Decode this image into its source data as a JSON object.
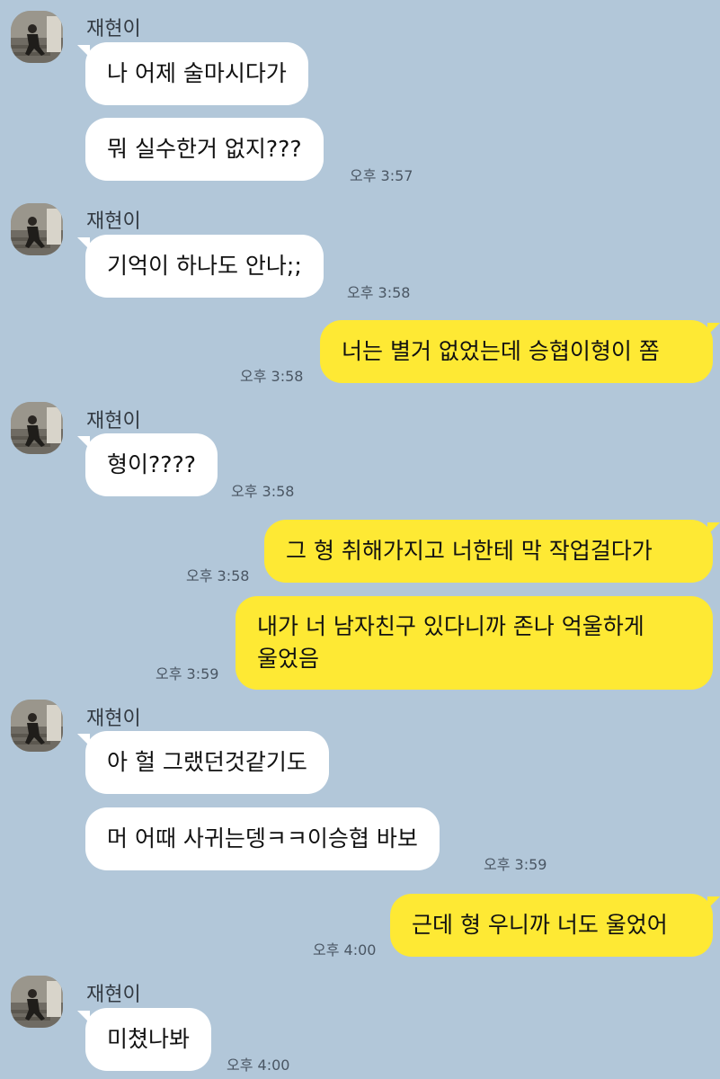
{
  "chat": {
    "partner_name": "재현이",
    "colors": {
      "background": "#b2c7d9",
      "my_bubble": "#fee934",
      "their_bubble": "#ffffff"
    },
    "messages": [
      {
        "from": "them",
        "text": "나 어제 술마시다가"
      },
      {
        "from": "them",
        "text": "뭐 실수한거 없지???",
        "time": "오후 3:57"
      },
      {
        "from": "them",
        "text": "기억이 하나도 안나;;",
        "time": "오후 3:58"
      },
      {
        "from": "me",
        "text": "너는 별거 없었는데 승협이형이 쫌",
        "time": "오후 3:58"
      },
      {
        "from": "them",
        "text": "형이????",
        "time": "오후 3:58"
      },
      {
        "from": "me",
        "text": "그 형 취해가지고 너한테 막 작업걸다가",
        "time": "오후 3:58"
      },
      {
        "from": "me",
        "line1": "내가 너 남자친구 있다니까 존나 억울하게",
        "line2": "울었음",
        "time": "오후 3:59"
      },
      {
        "from": "them",
        "text": "아 헐 그랬던것같기도"
      },
      {
        "from": "them",
        "text": "머 어때 사귀는뎅ㅋㅋ이승협 바보",
        "time": "오후 3:59"
      },
      {
        "from": "me",
        "text": "근데 형 우니까 너도 울었어",
        "time": "오후 4:00"
      },
      {
        "from": "them",
        "text": "미쳤나봐",
        "time": "오후 4:00"
      }
    ]
  }
}
